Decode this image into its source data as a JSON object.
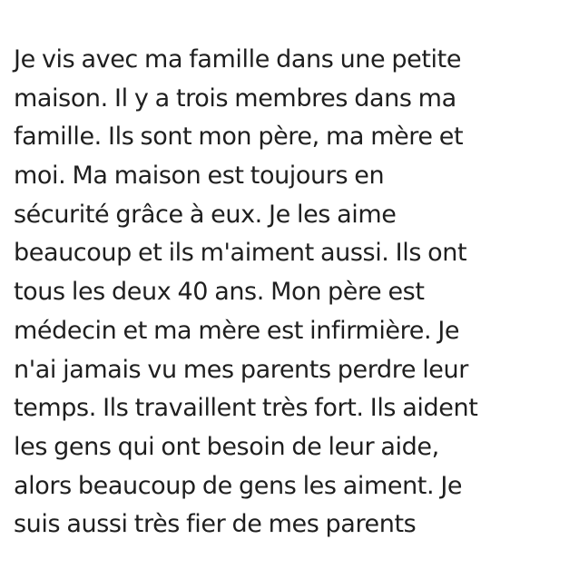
{
  "document": {
    "lines": [
      "Je vis avec ma famille dans une petite",
      "maison. Il y a trois membres dans ma",
      "famille. Ils sont mon père, ma mère et",
      "moi. Ma maison est toujours en",
      "sécurité grâce à eux. Je les aime",
      "beaucoup et ils m'aiment aussi. Ils ont",
      "tous les deux 40 ans. Mon père est",
      "médecin et ma mère est infirmière. Je",
      "n'ai jamais vu mes parents perdre leur",
      "temps. Ils travaillent très fort. Ils aident",
      "les gens qui ont besoin de leur aide,",
      "alors beaucoup de gens les aiment. Je",
      "suis aussi très fier de mes parents"
    ]
  }
}
